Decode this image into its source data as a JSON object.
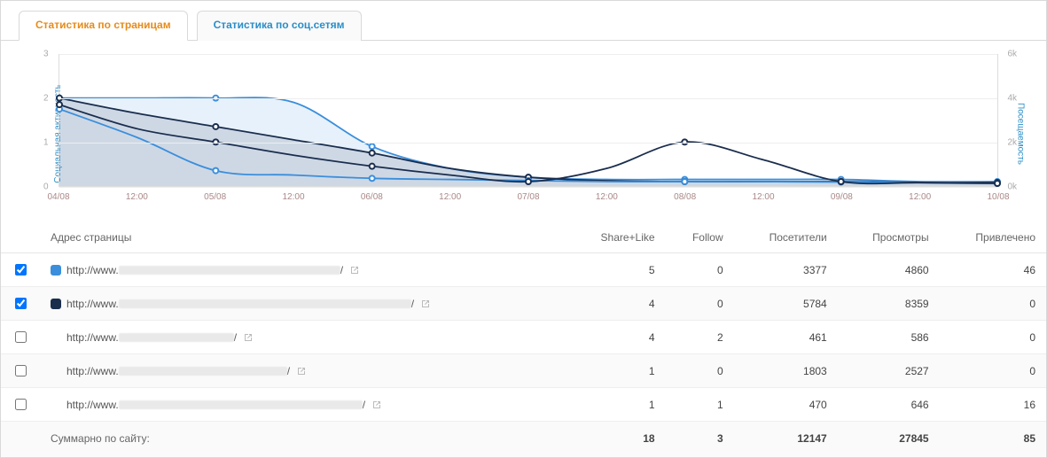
{
  "tabs": {
    "pages": "Статистика по страницам",
    "social": "Статистика по соц.сетям"
  },
  "chart_data": {
    "type": "line",
    "xlabel": "",
    "ylabel_left": "Социальная активность",
    "ylabel_right": "Посещаемость",
    "x_ticks": [
      "04/08",
      "12:00",
      "05/08",
      "12:00",
      "06/08",
      "12:00",
      "07/08",
      "12:00",
      "08/08",
      "12:00",
      "09/08",
      "12:00",
      "10/08"
    ],
    "y_left": {
      "ticks": [
        0,
        1,
        2,
        3
      ],
      "lim": [
        0,
        3
      ]
    },
    "y_right": {
      "ticks": [
        "0k",
        "2k",
        "4k",
        "6k"
      ],
      "lim": [
        0,
        6000
      ]
    },
    "series": [
      {
        "name": "page-1-social",
        "axis": "left",
        "color": "#3a8edb",
        "fill": true,
        "values": [
          2.0,
          2.0,
          2.0,
          1.9,
          0.9,
          0.4,
          0.2,
          0.15,
          0.15,
          0.15,
          0.15,
          0.1,
          0.1
        ]
      },
      {
        "name": "page-2-social",
        "axis": "left",
        "color": "#1a2d4d",
        "fill": true,
        "values": [
          2.0,
          1.65,
          1.35,
          1.05,
          0.75,
          0.4,
          0.2,
          0.12,
          0.1,
          0.1,
          0.1,
          0.08,
          0.08
        ]
      },
      {
        "name": "page-1-visits",
        "axis": "right",
        "color": "#3a8edb",
        "fill": false,
        "values": [
          3500,
          2200,
          700,
          500,
          350,
          300,
          250,
          200,
          200,
          200,
          180,
          150,
          120
        ]
      },
      {
        "name": "page-2-visits",
        "axis": "right",
        "color": "#1a2d4d",
        "fill": false,
        "values": [
          3700,
          2600,
          2000,
          1400,
          900,
          500,
          200,
          800,
          2000,
          1200,
          200,
          150,
          120
        ]
      }
    ]
  },
  "table": {
    "headers": {
      "address": "Адрес страницы",
      "share_like": "Share+Like",
      "follow": "Follow",
      "visitors": "Посетители",
      "views": "Просмотры",
      "attracted": "Привлечено"
    },
    "rows": [
      {
        "checked": true,
        "swatch": "#3a8edb",
        "url": "http://www.",
        "share_like": 5,
        "follow": 0,
        "visitors": 3377,
        "views": 4860,
        "attracted": 46
      },
      {
        "checked": true,
        "swatch": "#1a2d4d",
        "url": "http://www.",
        "share_like": 4,
        "follow": 0,
        "visitors": 5784,
        "views": 8359,
        "attracted": 0
      },
      {
        "checked": false,
        "swatch": "",
        "url": "http://www.",
        "share_like": 4,
        "follow": 2,
        "visitors": 461,
        "views": 586,
        "attracted": 0
      },
      {
        "checked": false,
        "swatch": "",
        "url": "http://www.",
        "share_like": 1,
        "follow": 0,
        "visitors": 1803,
        "views": 2527,
        "attracted": 0
      },
      {
        "checked": false,
        "swatch": "",
        "url": "http://www.",
        "share_like": 1,
        "follow": 1,
        "visitors": 470,
        "views": 646,
        "attracted": 16
      }
    ],
    "summary": {
      "label": "Суммарно по сайту:",
      "share_like": 18,
      "follow": 3,
      "visitors": 12147,
      "views": 27845,
      "attracted": 85
    }
  }
}
